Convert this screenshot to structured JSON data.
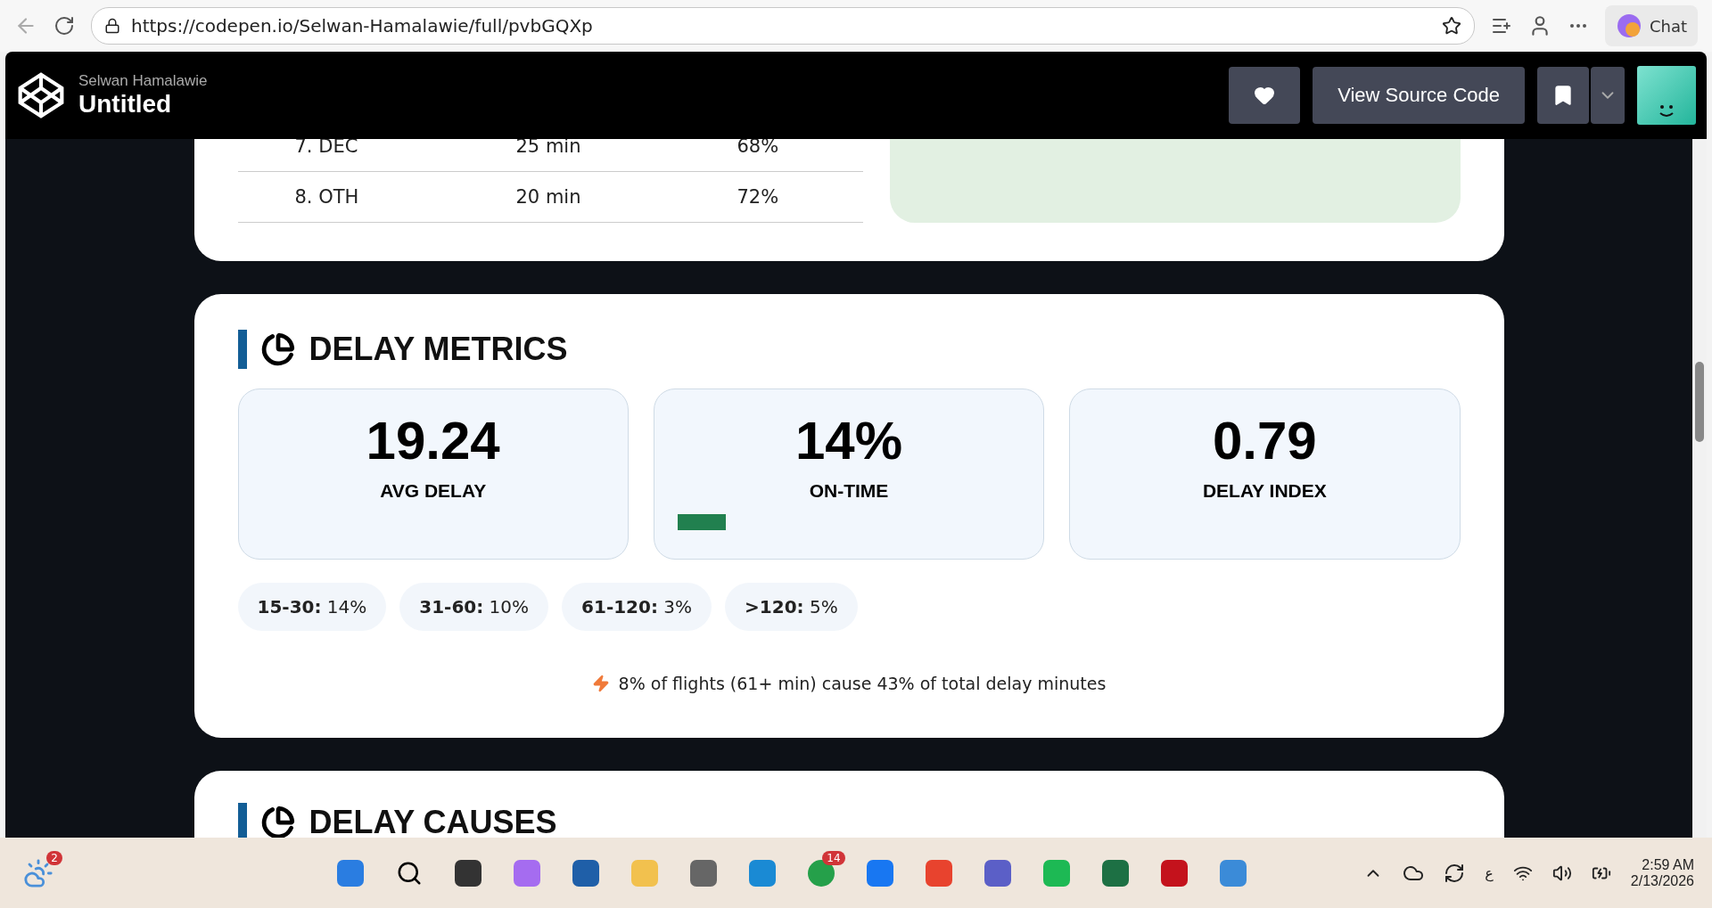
{
  "browser": {
    "url": "https://codepen.io/Selwan-Hamalawie/full/pvbGQXp",
    "chat_label": "Chat"
  },
  "header": {
    "author": "Selwan Hamalawie",
    "title": "Untitled",
    "source_button": "View Source Code"
  },
  "table": {
    "rows": [
      {
        "cells": [
          "7. DEC",
          "25 min",
          "68%"
        ]
      },
      {
        "cells": [
          "8. OTH",
          "20 min",
          "72%"
        ]
      }
    ]
  },
  "metrics": {
    "title": "DELAY METRICS",
    "cards": [
      {
        "value": "19.24",
        "label": "AVG DELAY"
      },
      {
        "value": "14%",
        "label": "ON-TIME",
        "level": 0.14
      },
      {
        "value": "0.79",
        "label": "DELAY INDEX"
      }
    ],
    "chips": [
      {
        "range": "15-30:",
        "value": "14%"
      },
      {
        "range": "31-60:",
        "value": "10%"
      },
      {
        "range": "61-120:",
        "value": "3%"
      },
      {
        "range": ">120:",
        "value": "5%"
      }
    ],
    "insight": "8% of flights (61+ min) cause 43% of total delay minutes"
  },
  "next_section": {
    "title": "DELAY CAUSES"
  },
  "taskbar": {
    "weather_badge": "2",
    "chat_badge": "14",
    "language": "ع",
    "time": "2:59 AM",
    "date": "2/13/2026"
  }
}
